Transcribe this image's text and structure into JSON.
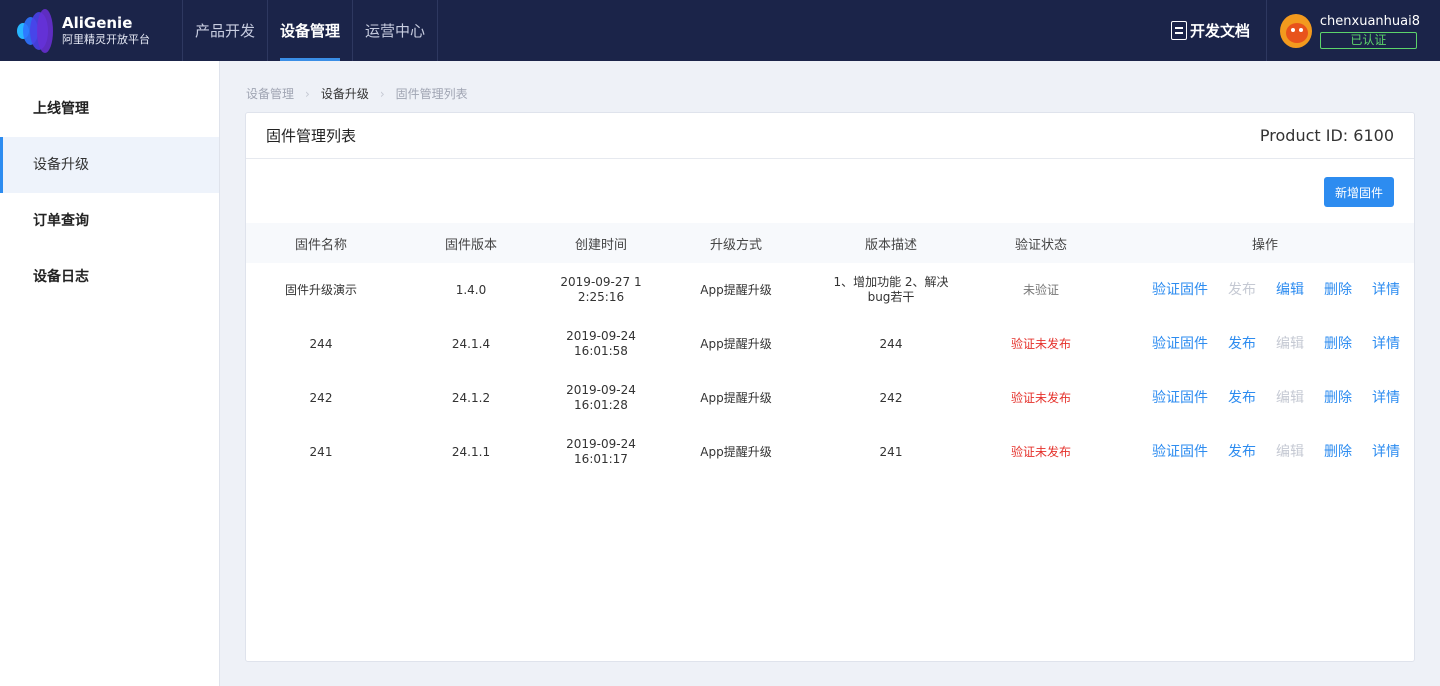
{
  "header": {
    "logo_title": "AliGenie",
    "logo_subtitle": "阿里精灵开放平台",
    "nav": [
      {
        "label": "产品开发"
      },
      {
        "label": "设备管理"
      },
      {
        "label": "运营中心"
      }
    ],
    "active_nav": "设备管理",
    "docs_label": "开发文档",
    "username": "chenxuanhuai8",
    "verified_label": "已认证"
  },
  "sidebar": {
    "items": [
      {
        "label": "上线管理"
      },
      {
        "label": "设备升级"
      },
      {
        "label": "订单查询"
      },
      {
        "label": "设备日志"
      }
    ],
    "active": "设备升级"
  },
  "breadcrumb": [
    "设备管理",
    "设备升级",
    "固件管理列表"
  ],
  "card": {
    "title": "固件管理列表",
    "product_id": "Product ID: 6100",
    "add_button": "新增固件"
  },
  "table": {
    "headers": [
      "固件名称",
      "固件版本",
      "创建时间",
      "升级方式",
      "版本描述",
      "验证状态",
      "操作"
    ],
    "rows": [
      {
        "name": "固件升级演示",
        "version": "1.4.0",
        "created": "2019-09-27 1\n2:25:16",
        "method": "App提醒升级",
        "desc": "1、增加功能 2、解决\nbug若干",
        "status": "未验证"
      },
      {
        "name": "244",
        "version": "24.1.4",
        "created": "2019-09-24\n16:01:58",
        "method": "App提醒升级",
        "desc": "244",
        "status": "验证未发布"
      },
      {
        "name": "242",
        "version": "24.1.2",
        "created": "2019-09-24\n16:01:28",
        "method": "App提醒升级",
        "desc": "242",
        "status": "验证未发布"
      },
      {
        "name": "241",
        "version": "24.1.1",
        "created": "2019-09-24\n16:01:17",
        "method": "App提醒升级",
        "desc": "241",
        "status": "验证未发布"
      }
    ],
    "actions": {
      "verify": "验证固件",
      "publish": "发布",
      "edit": "编辑",
      "delete": "删除",
      "detail": "详情"
    }
  },
  "colors": {
    "header_bg": "#1b2449",
    "accent": "#2d8cf0",
    "status_red": "#e5322c",
    "verified_green": "#5cd36b"
  }
}
